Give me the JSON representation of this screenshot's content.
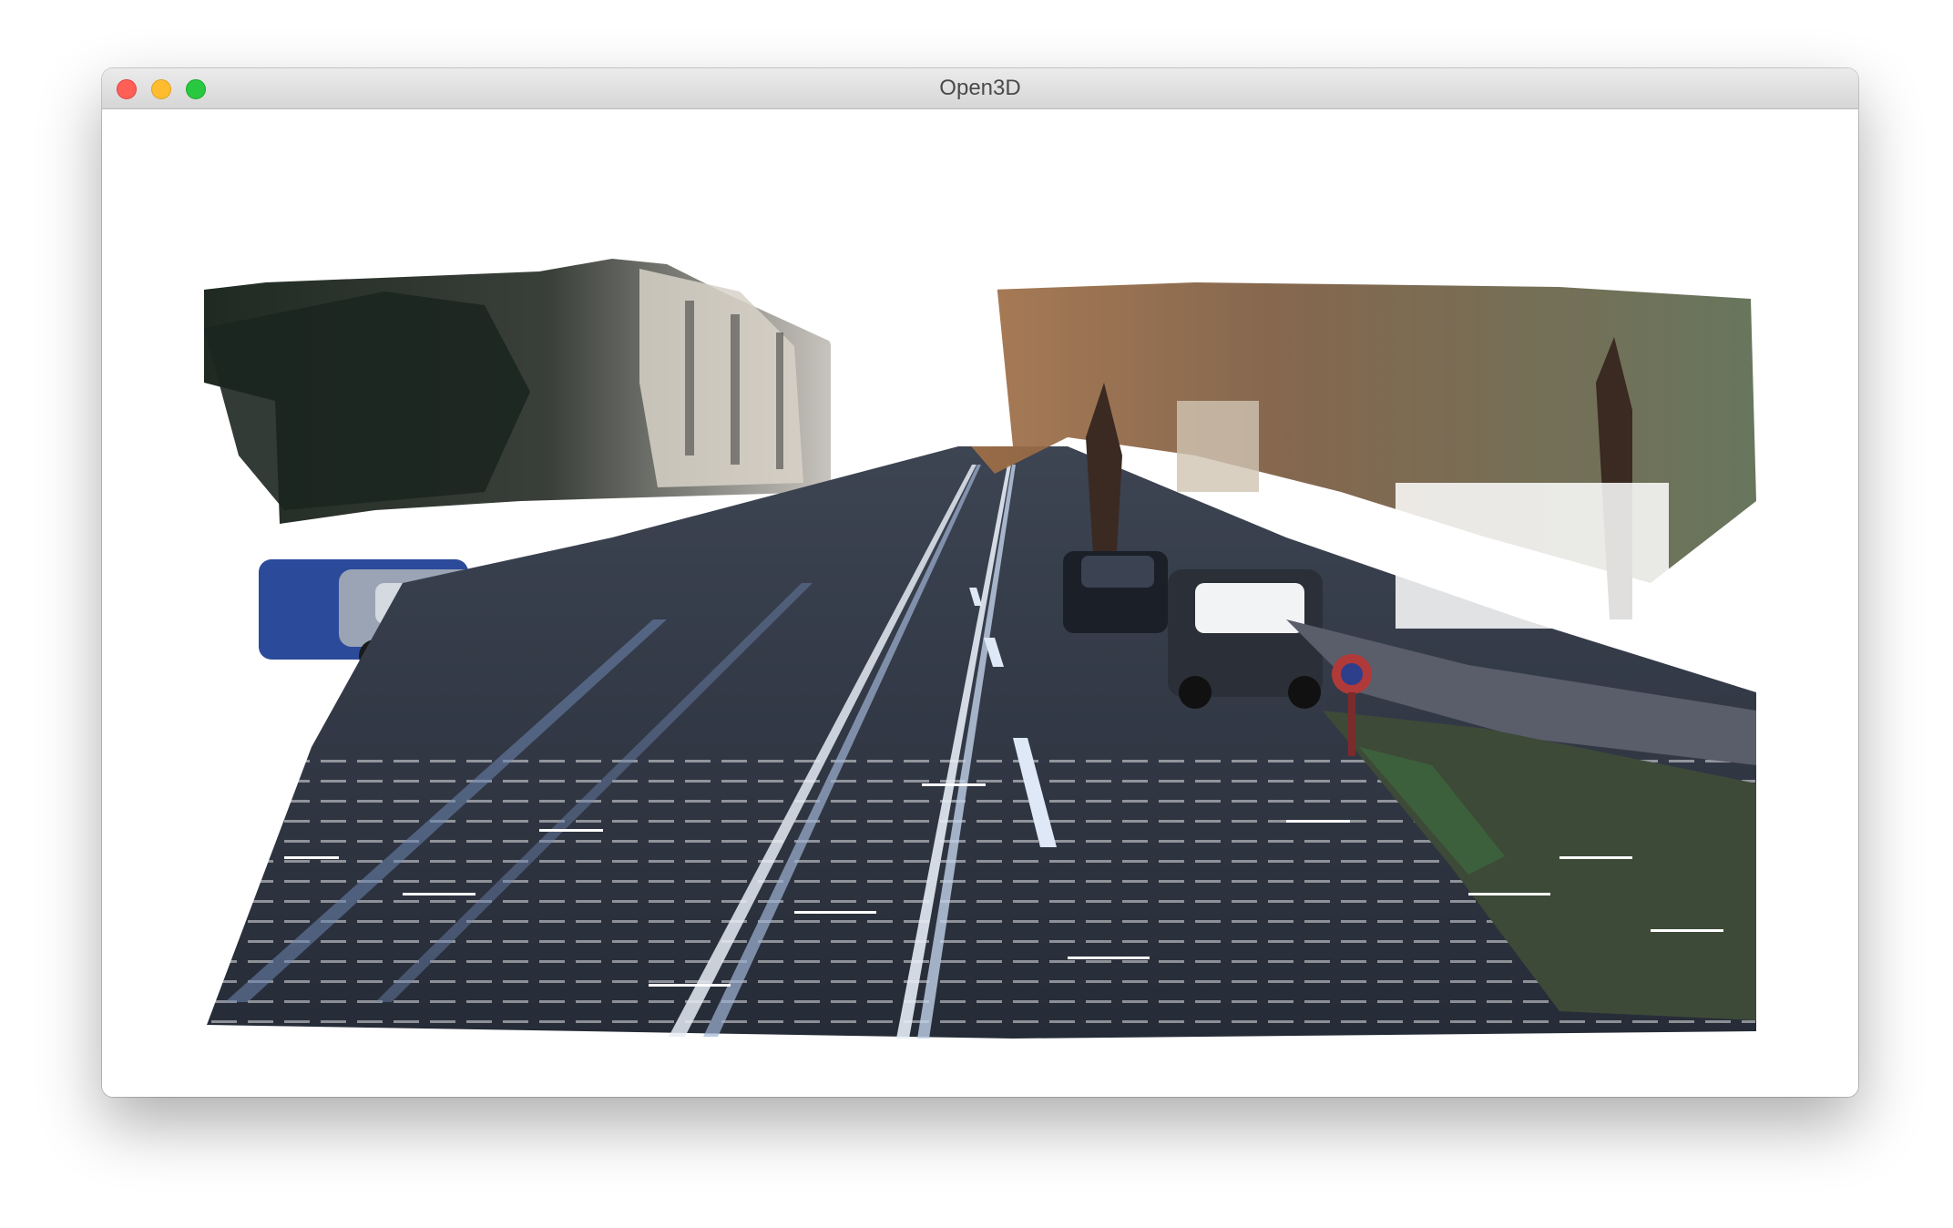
{
  "window": {
    "title": "Open3D",
    "controls": {
      "close": "close-button",
      "minimize": "minimize-button",
      "maximize": "maximize-button"
    }
  },
  "viewport": {
    "content": "colored-point-cloud-street-scene",
    "background_color": "#ffffff"
  },
  "colors": {
    "close": "#fe5f57",
    "minimize": "#febc2e",
    "maximize": "#28c840"
  }
}
